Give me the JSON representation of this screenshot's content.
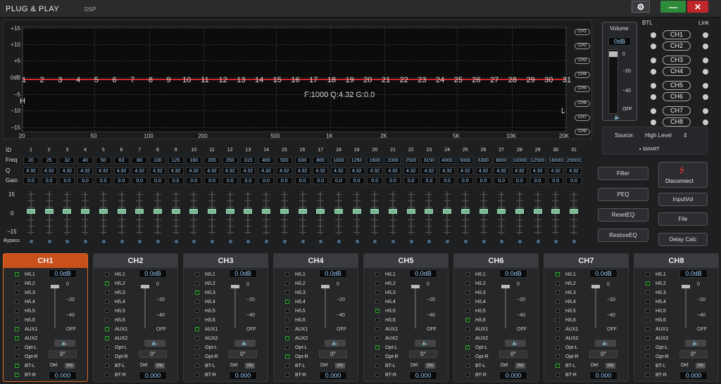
{
  "app": {
    "title": "PLUG & PLAY",
    "subtitle": "DSP"
  },
  "window": {
    "gear": "⚙",
    "minimize": "—",
    "close": "✕"
  },
  "graph": {
    "y_labels": [
      "+15",
      "+10",
      "+5",
      "0dB",
      "−5",
      "−10",
      "−15"
    ],
    "x_labels": [
      "20",
      "50",
      "100",
      "200",
      "500",
      "1K",
      "2K",
      "5K",
      "10K",
      "20K"
    ],
    "band_numbers": [
      "1",
      "2",
      "3",
      "4",
      "5",
      "6",
      "7",
      "8",
      "9",
      "10",
      "11",
      "12",
      "13",
      "14",
      "15",
      "16",
      "17",
      "18",
      "19",
      "20",
      "21",
      "22",
      "23",
      "24",
      "25",
      "26",
      "27",
      "28",
      "29",
      "30",
      "31"
    ],
    "info": "F:1000 Q:4.32 G:0.0",
    "h_marker": "H",
    "l_marker": "L",
    "channel_tags": [
      "CH1",
      "CH2",
      "CH3",
      "CH4",
      "CH5",
      "CH6",
      "CH7",
      "CH8"
    ]
  },
  "volume": {
    "title": "Volume",
    "value": "0dB",
    "scale": [
      "0",
      "−20",
      "−40",
      "OFF"
    ],
    "mute_icon": "🔈"
  },
  "btl": {
    "label": "BTL",
    "link_label": "Link",
    "channels": [
      "CH1",
      "CH2",
      "CH3",
      "CH4",
      "CH5",
      "CH6",
      "CH7",
      "CH8"
    ]
  },
  "source": {
    "label": "Source:",
    "value": "High Level",
    "smart": "SMART"
  },
  "eq": {
    "row_labels": {
      "id": "ID",
      "freq": "Freq",
      "q": "Q",
      "gain": "Gain"
    },
    "ids": [
      "1",
      "2",
      "3",
      "4",
      "5",
      "6",
      "7",
      "8",
      "9",
      "10",
      "11",
      "12",
      "13",
      "14",
      "15",
      "16",
      "17",
      "18",
      "19",
      "20",
      "21",
      "22",
      "23",
      "24",
      "25",
      "26",
      "27",
      "28",
      "29",
      "30",
      "31"
    ],
    "freqs": [
      "20",
      "25",
      "32",
      "40",
      "50",
      "63",
      "80",
      "100",
      "125",
      "160",
      "200",
      "250",
      "315",
      "400",
      "500",
      "630",
      "800",
      "1000",
      "1250",
      "1600",
      "2000",
      "2500",
      "3150",
      "4000",
      "5000",
      "6300",
      "8000",
      "10000",
      "12500",
      "16000",
      "20000"
    ],
    "q_value": "4.32",
    "gain_value": "0.0",
    "fader_scale": [
      "15",
      "0",
      "−15"
    ],
    "bypass_label": "Bypass"
  },
  "buttons": {
    "filter": "Filter",
    "peq": "PEQ",
    "reset": "ResetEQ",
    "restore": "RestoreEQ",
    "disconnect": "Disconnect",
    "inputvol": "InputVol",
    "file": "File",
    "delay": "Delay Calc"
  },
  "channels": [
    {
      "name": "CH1",
      "checked": [
        1,
        0,
        0,
        0,
        0,
        0,
        1,
        1,
        0,
        0,
        1,
        1
      ]
    },
    {
      "name": "CH2",
      "checked": [
        0,
        1,
        0,
        0,
        0,
        0,
        1,
        1,
        0,
        0,
        0,
        0
      ]
    },
    {
      "name": "CH3",
      "checked": [
        0,
        0,
        1,
        0,
        0,
        0,
        1,
        0,
        0,
        0,
        0,
        0
      ]
    },
    {
      "name": "CH4",
      "checked": [
        0,
        0,
        0,
        1,
        0,
        0,
        0,
        1,
        0,
        1,
        0,
        0
      ]
    },
    {
      "name": "CH5",
      "checked": [
        0,
        0,
        0,
        0,
        1,
        0,
        0,
        0,
        1,
        0,
        0,
        0
      ]
    },
    {
      "name": "CH6",
      "checked": [
        0,
        0,
        0,
        0,
        0,
        1,
        0,
        0,
        1,
        0,
        0,
        0
      ]
    },
    {
      "name": "CH7",
      "checked": [
        1,
        0,
        0,
        0,
        0,
        0,
        0,
        0,
        0,
        0,
        1,
        0
      ]
    },
    {
      "name": "CH8",
      "checked": [
        0,
        1,
        0,
        0,
        0,
        0,
        0,
        0,
        0,
        0,
        0,
        0
      ]
    }
  ],
  "channel_rows": [
    "H/L1",
    "H/L2",
    "H/L3",
    "H/L4",
    "H/L5",
    "H/L6",
    "AUX1",
    "AUX2",
    "Opt-L",
    "Opt-R",
    "BT-L",
    "BT-R"
  ],
  "channel_common": {
    "db": "0.0dB",
    "phase": "0°",
    "del": "Del",
    "ms": "ms",
    "delay": "0.000",
    "scale": [
      "0",
      "−20",
      "−40",
      "OFF"
    ],
    "mute": "🔈"
  }
}
